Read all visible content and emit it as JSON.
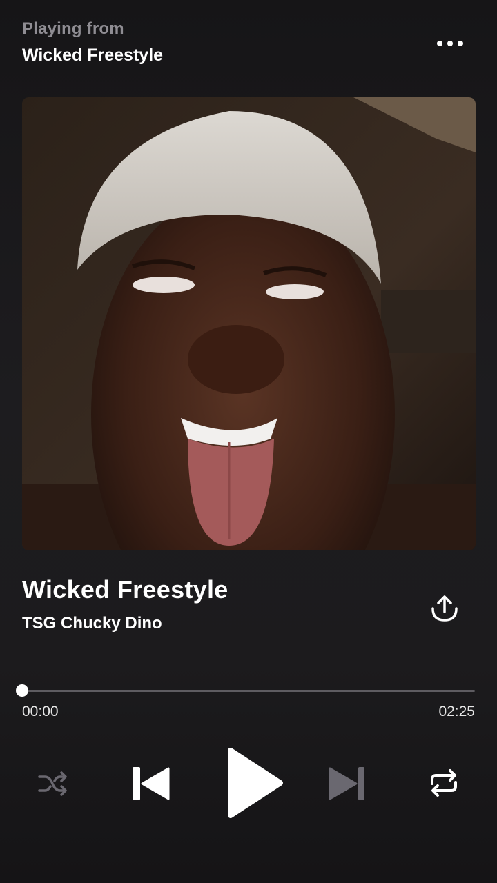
{
  "header": {
    "playing_from_label": "Playing from",
    "source_title": "Wicked Freestyle"
  },
  "track": {
    "title": "Wicked Freestyle",
    "artist": "TSG Chucky Dino"
  },
  "playback": {
    "elapsed": "00:00",
    "duration": "02:25",
    "progress_fraction": 0.0
  },
  "icons": {
    "more": "more-horizontal-icon",
    "share": "share-upload-icon",
    "shuffle": "shuffle-icon",
    "previous": "skip-previous-icon",
    "play": "play-icon",
    "next": "skip-next-icon",
    "repeat": "repeat-icon"
  },
  "colors": {
    "background": "#1b1a1c",
    "text_primary": "#ffffff",
    "text_secondary": "#8f8d93",
    "control_disabled": "#6a6870"
  }
}
